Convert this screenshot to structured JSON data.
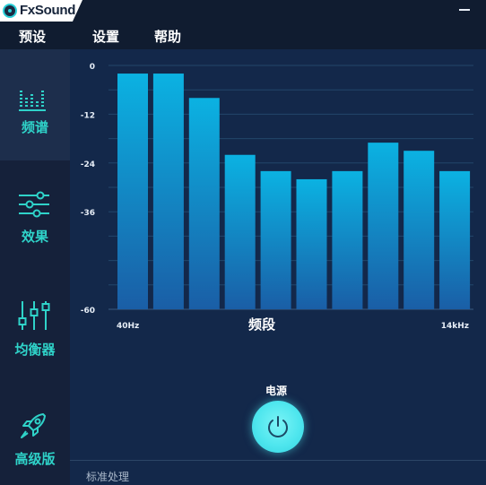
{
  "app": {
    "logo_text": "FxSound"
  },
  "menu": {
    "presets": "预设",
    "settings": "设置",
    "help": "帮助"
  },
  "sidebar": {
    "items": [
      {
        "label": "频谱",
        "icon": "spectrum-icon",
        "active": true
      },
      {
        "label": "效果",
        "icon": "effects-sliders-icon",
        "active": false
      },
      {
        "label": "均衡器",
        "icon": "equalizer-icon",
        "active": false
      },
      {
        "label": "高级版",
        "icon": "rocket-icon",
        "active": false
      }
    ]
  },
  "chart_data": {
    "type": "bar",
    "xlabel": "频段",
    "ylim": [
      -60,
      0
    ],
    "yticks": [
      "0",
      "-12",
      "-24",
      "-36",
      "-60"
    ],
    "x_endpoints": [
      "40Hz",
      "14kHz"
    ],
    "values": [
      -2,
      -2,
      -8,
      -22,
      -26,
      -28,
      -26,
      -19,
      -21,
      -26
    ],
    "bar_color": "#0aa9dd",
    "grid": true
  },
  "power": {
    "label": "电源",
    "state": "on",
    "color": "#4fe6ee"
  },
  "status": {
    "text": "标准处理"
  }
}
